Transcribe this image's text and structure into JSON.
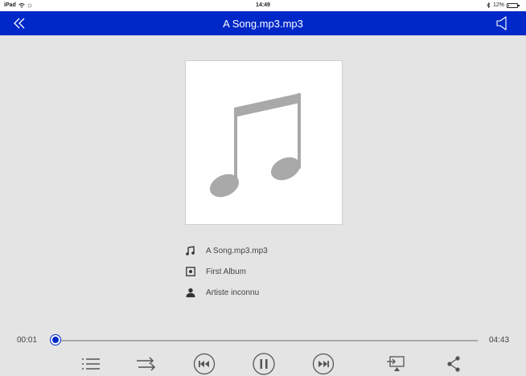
{
  "status_bar": {
    "device": "iPad",
    "time": "14:49",
    "battery_percent": "12%",
    "battery_level": 0.12
  },
  "header": {
    "title": "A Song.mp3.mp3"
  },
  "now_playing": {
    "song": "A Song.mp3.mp3",
    "album": "First Album",
    "artist": "Artiste inconnu"
  },
  "progress": {
    "elapsed": "00:01",
    "duration": "04:43",
    "fraction": 0.004
  },
  "icons": {
    "back": "double-chevron-left-icon",
    "volume": "speaker-icon",
    "song": "music-note-icon",
    "album": "album-icon",
    "artist": "person-icon",
    "playlist": "list-icon",
    "repeat": "repeat-icon",
    "previous": "previous-track-icon",
    "pause": "pause-icon",
    "next": "next-track-icon",
    "cast": "cast-screen-icon",
    "share": "share-icon"
  },
  "colors": {
    "accent": "#0028c8",
    "background": "#e4e4e4",
    "icon_gray": "#555555",
    "artwork_gray": "#a9a9a9"
  }
}
